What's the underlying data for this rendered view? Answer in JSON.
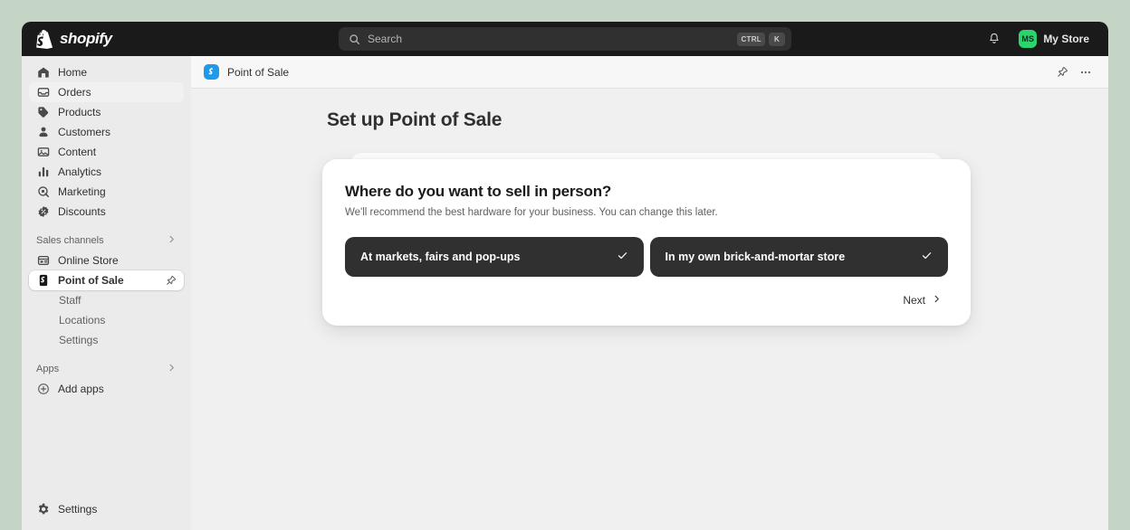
{
  "topbar": {
    "brand": "shopify",
    "brand_logo_icon": "shopify-bag-icon",
    "search": {
      "icon": "search-icon",
      "placeholder": "Search",
      "shortcut_keys": [
        "CTRL",
        "K"
      ]
    },
    "notifications_icon": "bell-icon",
    "store": {
      "initials": "MS",
      "name": "My Store",
      "avatar_color": "#2bd46d"
    }
  },
  "sidebar": {
    "items": [
      {
        "label": "Home",
        "icon": "home-icon",
        "state": "default"
      },
      {
        "label": "Orders",
        "icon": "orders-inbox-icon",
        "state": "hovered"
      },
      {
        "label": "Products",
        "icon": "tag-icon",
        "state": "default"
      },
      {
        "label": "Customers",
        "icon": "person-icon",
        "state": "default"
      },
      {
        "label": "Content",
        "icon": "content-image-icon",
        "state": "default"
      },
      {
        "label": "Analytics",
        "icon": "bar-chart-icon",
        "state": "default"
      },
      {
        "label": "Marketing",
        "icon": "megaphone-target-icon",
        "state": "default"
      },
      {
        "label": "Discounts",
        "icon": "discount-gear-icon",
        "state": "default"
      }
    ],
    "sales_channels": {
      "label": "Sales channels",
      "chevron_icon": "chevron-right-icon",
      "items": [
        {
          "label": "Online Store",
          "icon": "storefront-icon",
          "state": "default"
        },
        {
          "label": "Point of Sale",
          "icon": "pos-shopify-icon",
          "state": "selected",
          "trailing_icon": "pin-icon"
        }
      ],
      "sub_items": [
        {
          "label": "Staff"
        },
        {
          "label": "Locations"
        },
        {
          "label": "Settings"
        }
      ]
    },
    "apps": {
      "label": "Apps",
      "chevron_icon": "chevron-right-icon",
      "items": [
        {
          "label": "Add apps",
          "icon": "plus-circle-icon"
        }
      ]
    },
    "footer": {
      "label": "Settings",
      "icon": "gear-icon"
    }
  },
  "app_header": {
    "app_icon": "pos-app-icon",
    "app_icon_color": "#1f9ae8",
    "title": "Point of Sale",
    "pin_icon": "pin-icon",
    "more_icon": "ellipsis-horizontal-icon"
  },
  "main": {
    "page_title": "Set up Point of Sale",
    "modal": {
      "heading": "Where do you want to sell in person?",
      "subtitle": "We'll recommend the best hardware for your business. You can change this later.",
      "options": [
        {
          "label": "At markets, fairs and pop-ups",
          "selected": true,
          "check_icon": "check-icon"
        },
        {
          "label": "In my own brick-and-mortar store",
          "selected": true,
          "check_icon": "check-icon"
        }
      ],
      "next_label": "Next",
      "next_icon": "chevron-right-icon"
    }
  }
}
